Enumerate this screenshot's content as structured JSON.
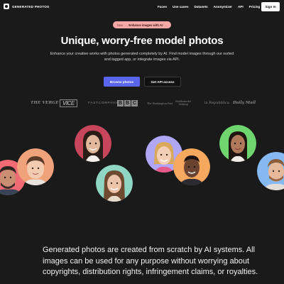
{
  "nav": {
    "brand": "GENERATED PHOTOS",
    "links": [
      "Faces",
      "Use cases",
      "Datasets",
      "Anonymizer",
      "API",
      "Pricing"
    ],
    "signin": "Sign In"
  },
  "badge": {
    "new": "New",
    "separator": "→",
    "cta": "Enhance images with AI",
    "arrow": "→"
  },
  "hero": {
    "title": "Unique, worry-free model photos",
    "subtitle": "Enhance your creative works with photos generated completely by AI. Find model images through our sorted and tagged app, or integrate images via API."
  },
  "buttons": {
    "browse": "Browse photos",
    "api": "Get API access"
  },
  "press": {
    "verge": "THE VERGE",
    "vice": "VICE",
    "fastcompany": "FASTCOMPANY",
    "bbc": [
      "B",
      "B",
      "C"
    ],
    "wapo": "The Washington Post",
    "sz_line1": "Süddeutsche",
    "sz_line2": "Zeitung",
    "repubblica": "la Repubblica",
    "dailymail": "Daily Mail"
  },
  "faces": {
    "ring_colors": [
      "#f06b74",
      "#f0a27a",
      "#c7465b",
      "#8fd7c4",
      "#b1a6f4",
      "#f5a85e",
      "#6ed56f",
      "#86b8f2"
    ]
  },
  "body": {
    "text": "Generated photos are created from scratch by AI systems. All images can be used for any purpose without worrying about copyrights, distribution rights, infringement claims, or royalties."
  }
}
